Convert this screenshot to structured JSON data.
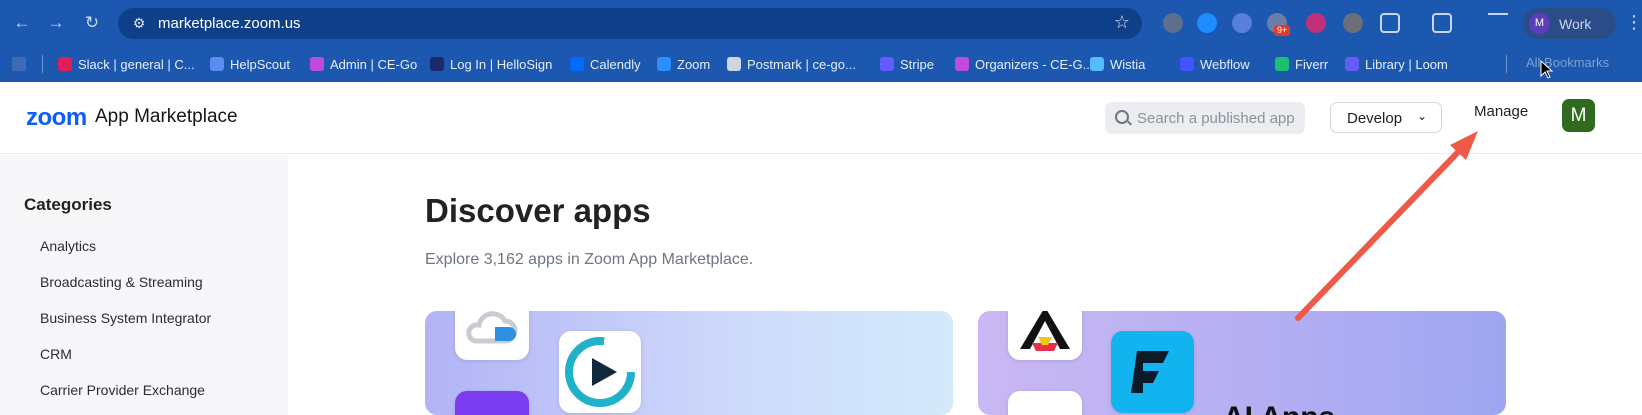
{
  "browser": {
    "url": "marketplace.zoom.us",
    "profile_label": "Work",
    "profile_initial": "M",
    "extension_badge": "9+",
    "all_bookmarks_label": "All Bookmarks",
    "bookmarks": [
      {
        "label": "Slack | general | C...",
        "icon": "slack-icon",
        "color": "#e01e5a"
      },
      {
        "label": "HelpScout",
        "icon": "helpscout-icon",
        "color": "#5a8dee"
      },
      {
        "label": "Admin | CE-Go",
        "icon": "ce-go-icon",
        "color": "#c04bd8"
      },
      {
        "label": "Log In | HelloSign",
        "icon": "hellosign-icon",
        "color": "#1b2a6b"
      },
      {
        "label": "Calendly",
        "icon": "calendly-icon",
        "color": "#006bff"
      },
      {
        "label": "Zoom",
        "icon": "zoom-icon",
        "color": "#2d8cff"
      },
      {
        "label": "Postmark | ce-go...",
        "icon": "globe-icon",
        "color": "#d0d6e0"
      },
      {
        "label": "Stripe",
        "icon": "stripe-icon",
        "color": "#635bff"
      },
      {
        "label": "Organizers - CE-G...",
        "icon": "ce-go-icon",
        "color": "#c04bd8"
      },
      {
        "label": "Wistia",
        "icon": "wistia-icon",
        "color": "#54bbff"
      },
      {
        "label": "Webflow",
        "icon": "webflow-icon",
        "color": "#4353ff"
      },
      {
        "label": "Fiverr",
        "icon": "fiverr-icon",
        "color": "#1dbf73"
      },
      {
        "label": "Library | Loom",
        "icon": "loom-icon",
        "color": "#625df5"
      }
    ]
  },
  "header": {
    "logo_brand": "zoom",
    "logo_text": "App Marketplace",
    "search_placeholder": "Search a published app",
    "develop_label": "Develop",
    "manage_label": "Manage",
    "avatar_initial": "M"
  },
  "sidebar": {
    "title": "Categories",
    "items": [
      "Analytics",
      "Broadcasting & Streaming",
      "Business System Integrator",
      "CRM",
      "Carrier Provider Exchange"
    ]
  },
  "main": {
    "title": "Discover apps",
    "subtitle": "Explore 3,162 apps in Zoom App Marketplace.",
    "cards": [
      {
        "title": ""
      },
      {
        "title": "AI Apps"
      }
    ]
  },
  "colors": {
    "chrome_blue": "#1c57b0",
    "zoom_blue": "#0b5cff",
    "annotation_arrow": "#ef5a48",
    "avatar_green": "#2f6a1e"
  }
}
